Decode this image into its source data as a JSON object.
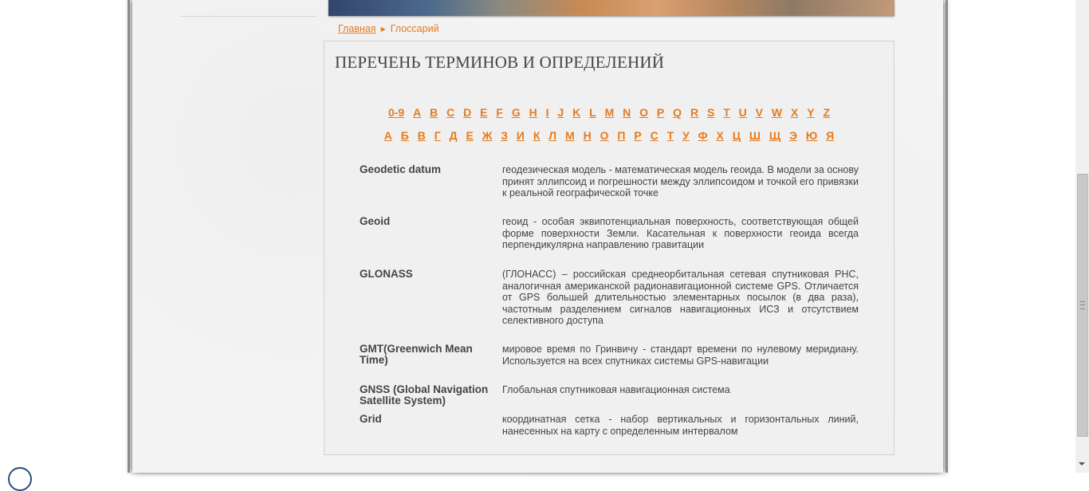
{
  "breadcrumb": {
    "home": "Главная",
    "current": "Глоссарий"
  },
  "title": "ПЕРЕЧЕНЬ ТЕРМИНОВ И ОПРЕДЕЛЕНИЙ",
  "latin_letters": [
    "0-9",
    "A",
    "B",
    "C",
    "D",
    "E",
    "F",
    "G",
    "H",
    "I",
    "J",
    "K",
    "L",
    "M",
    "N",
    "O",
    "P",
    "Q",
    "R",
    "S",
    "T",
    "U",
    "V",
    "W",
    "X",
    "Y",
    "Z"
  ],
  "cyrillic_letters": [
    "А",
    "Б",
    "В",
    "Г",
    "Д",
    "Е",
    "Ж",
    "З",
    "И",
    "К",
    "Л",
    "М",
    "Н",
    "О",
    "П",
    "Р",
    "С",
    "Т",
    "У",
    "Ф",
    "Х",
    "Ц",
    "Ш",
    "Щ",
    "Э",
    "Ю",
    "Я"
  ],
  "glossary": [
    {
      "term": "Geodetic datum",
      "definition": "геодезическая модель - математическая модель геоида. В модели за основу принят эллипсоид и погрешности между эллипсоидом и точкой его привязки к реальной географической точке"
    },
    {
      "term": "Geoid",
      "definition": "геоид - особая эквипотенциальная поверхность, соответствующая общей форме поверхности Земли. Касательная к поверхности геоида всегда перпендикулярна направлению гравитации"
    },
    {
      "term": "GLONASS",
      "definition": "(ГЛОНАСС) – российская среднеорбитальная сетевая спутниковая РНС, аналогичная американской радионавигационной системе GPS. Отличается от GPS большей длительностью элементарных посылок (в два раза), частотным разделением сигналов навигационных ИСЗ и отсутствием селективного доступа"
    },
    {
      "term": "GMT(Greenwich Mean Time)",
      "definition": "мировое время по Гринвичу - стандарт времени по нулевому меридиану. Используется на всех спутниках системы GPS-навигации"
    },
    {
      "term": "GNSS (Global Navigation Satellite System)",
      "definition": "Глобальная спутниковая навигационная система"
    },
    {
      "term": "Grid",
      "definition": "координатная сетка - набор вертикальных и горизонтальных линий, нанесенных на карту с определенным интервалом"
    }
  ],
  "colors": {
    "link": "#e67a1e",
    "text": "#444444",
    "box_bg": "#f0f0f0"
  }
}
